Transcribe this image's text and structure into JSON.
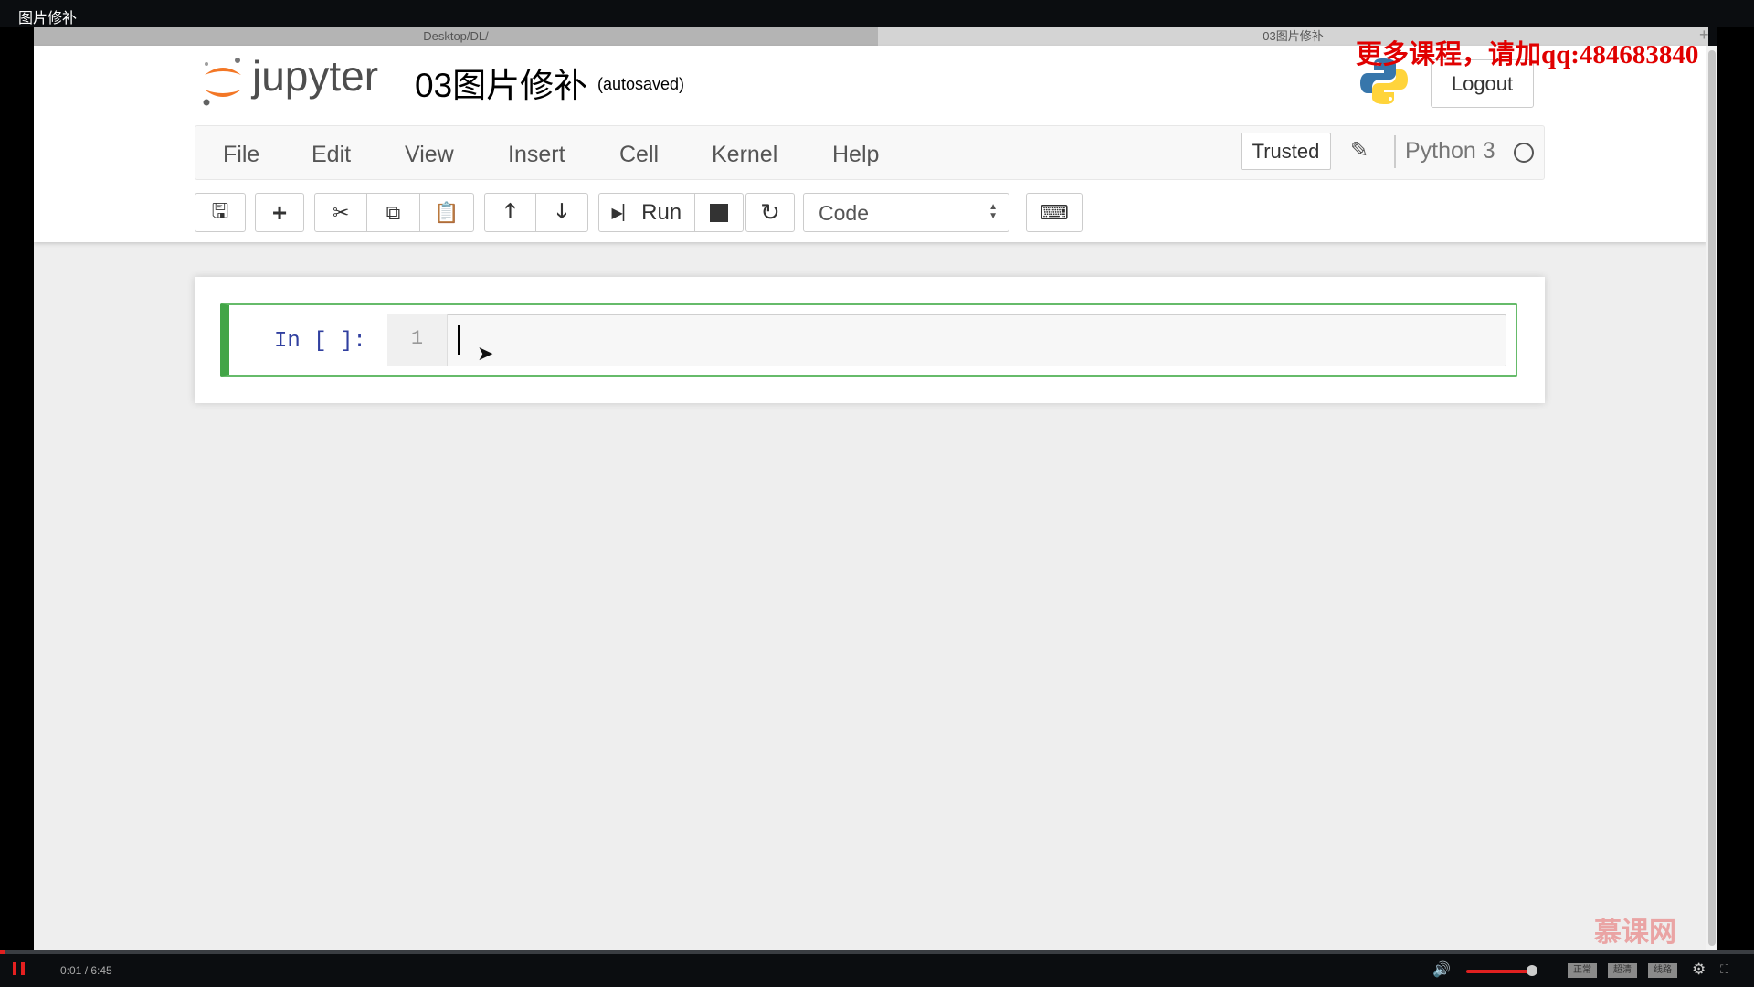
{
  "window_title": "图片修补",
  "browser_tabs": [
    {
      "label": "Desktop/DL/",
      "active": false
    },
    {
      "label": "03图片修补",
      "active": true
    }
  ],
  "overlay_watermark": "更多课程，请加qq:484683840",
  "header": {
    "logo_text": "jupyter",
    "notebook_title": "03图片修补",
    "save_status": "(autosaved)",
    "logout_label": "Logout"
  },
  "menubar": {
    "items": [
      "File",
      "Edit",
      "View",
      "Insert",
      "Cell",
      "Kernel",
      "Help"
    ],
    "trusted_label": "Trusted",
    "kernel_name": "Python 3",
    "kernel_status": "idle"
  },
  "toolbar": {
    "buttons": [
      "save-icon",
      "plus-icon",
      "cut-icon",
      "copy-icon",
      "paste-icon",
      "arrow-up-icon",
      "arrow-down-icon",
      "run",
      "stop-icon",
      "restart-icon",
      "keyboard-icon"
    ],
    "run_label": "Run",
    "cell_type": "Code"
  },
  "cell": {
    "prompt": "In [ ]:",
    "line_number": "1",
    "code": ""
  },
  "site_logo": "慕课网",
  "player": {
    "time": "0:01 / 6:45",
    "progress_fraction": 0.0025,
    "volume_fraction": 0.9,
    "buttons": [
      "正常",
      "超清",
      "线路"
    ],
    "accent": "#e02020"
  }
}
